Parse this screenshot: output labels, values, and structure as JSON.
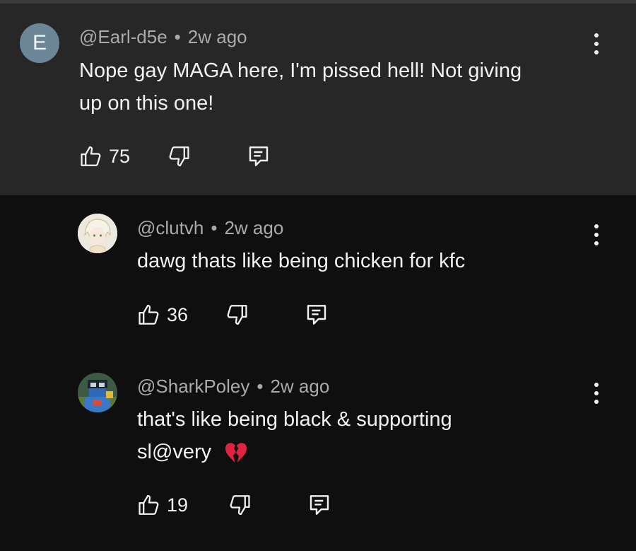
{
  "comments": [
    {
      "avatar_letter": "E",
      "author": "@Earl-d5e",
      "time": "2w ago",
      "text_line1": "Nope gay MAGA here, I'm pissed hell! Not giving",
      "text_line2": "up on this one!",
      "likes": "75"
    },
    {
      "author": "@clutvh",
      "time": "2w ago",
      "text_line1": "dawg thats like being chicken for kfc",
      "likes": "36"
    },
    {
      "author": "@SharkPoley",
      "time": "2w ago",
      "text_line1": "that's like being black & supporting",
      "text_line2": "sl@very",
      "text_emoji": "broken-heart-emoji",
      "likes": "19"
    }
  ],
  "colors": {
    "background": "#0f0f0f",
    "highlight": "#272727",
    "meta_text": "#aaaaaa",
    "avatar_e": "#6b8696",
    "heart_red": "#e0243f"
  },
  "icons": [
    "thumb-up-icon",
    "thumb-down-icon",
    "reply-icon",
    "more-vert-icon"
  ]
}
